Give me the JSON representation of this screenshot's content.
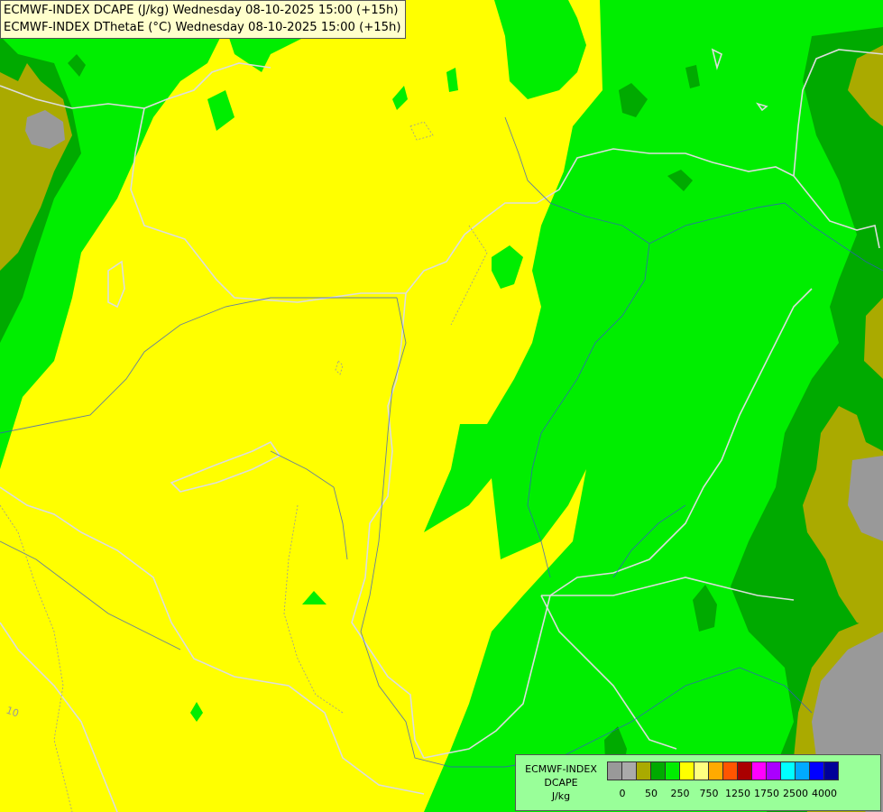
{
  "titles": [
    "ECMWF-INDEX DCAPE (J/kg) Wednesday 08-10-2025 15:00 (+15h)",
    "ECMWF-INDEX DThetaE (°C) Wednesday 08-10-2025 15:00 (+15h)"
  ],
  "legend": {
    "label_lines": [
      "ECMWF-INDEX",
      "DCAPE",
      "J/kg"
    ],
    "colors": [
      "#999999",
      "#aaaaaa",
      "#aaaa00",
      "#00aa00",
      "#00ee00",
      "#ffff00",
      "#ffff80",
      "#ffaa00",
      "#ff5500",
      "#aa0000",
      "#ff00ff",
      "#aa00ff",
      "#00ffff",
      "#00aaff",
      "#0000ff",
      "#000099"
    ],
    "ticks": [
      "0",
      "50",
      "250",
      "750",
      "1250",
      "1750",
      "2500",
      "4000"
    ]
  },
  "map": {
    "contour_label": "10"
  }
}
